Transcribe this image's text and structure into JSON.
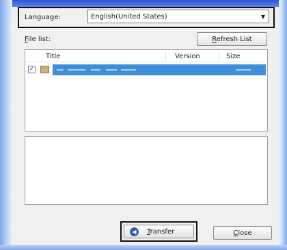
{
  "language": {
    "label": "Language:",
    "value": "English(United States)",
    "arrow_icon": "dropdown-arrow-icon"
  },
  "file_list": {
    "label_mnemonic": "F",
    "label_rest": "ile list:",
    "refresh_mnemonic": "R",
    "refresh_rest": "efresh List",
    "columns": [
      "Title",
      "Version",
      "Size"
    ],
    "rows": [
      {
        "checked": true,
        "check_glyph": "✓",
        "icon": "folder-icon"
      }
    ]
  },
  "buttons": {
    "transfer_mnemonic": "T",
    "transfer_rest": "ransfer",
    "transfer_icon_glyph": "◀",
    "close_mnemonic": "C",
    "close_rest": "lose"
  },
  "colors": {
    "selection": "#3f8fd8",
    "frame_blue": "#7fa6ea"
  }
}
